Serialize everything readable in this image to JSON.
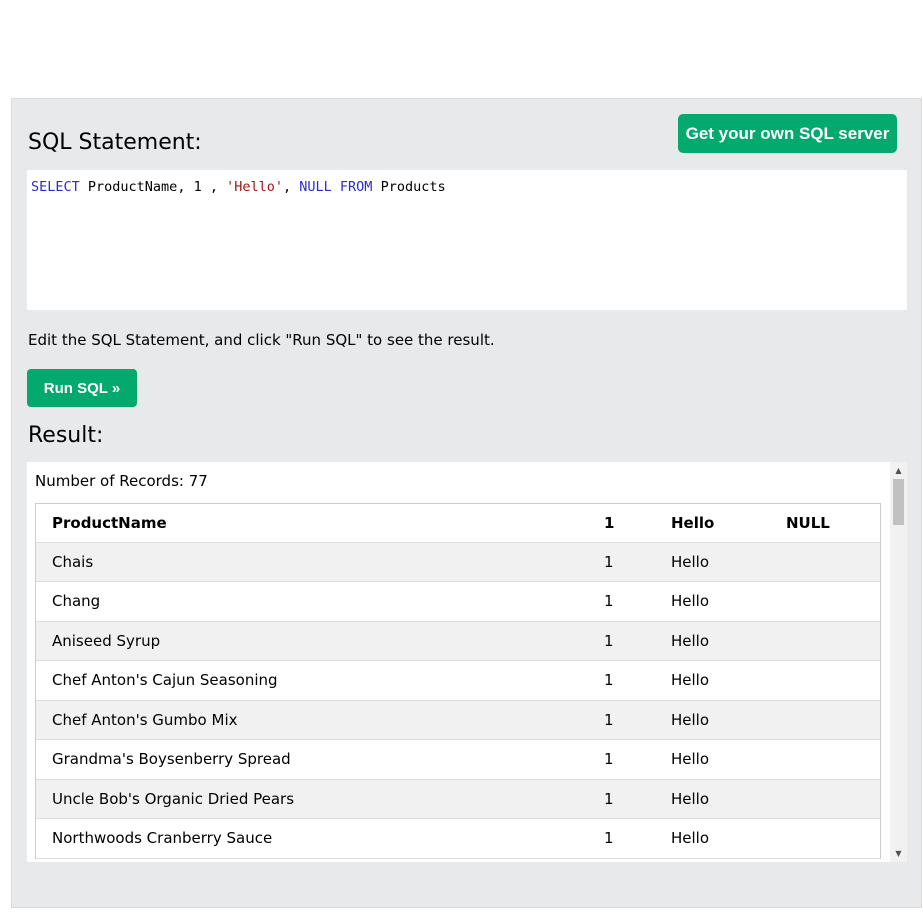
{
  "header": {
    "sql_title": "SQL Statement:",
    "own_server_button": "Get your own SQL server"
  },
  "editor": {
    "tokens": [
      {
        "text": "SELECT",
        "type": "keyword"
      },
      {
        "text": " ProductName, 1 , ",
        "type": "plain"
      },
      {
        "text": "'Hello'",
        "type": "string"
      },
      {
        "text": ", ",
        "type": "plain"
      },
      {
        "text": "NULL",
        "type": "keyword"
      },
      {
        "text": " ",
        "type": "plain"
      },
      {
        "text": "FROM",
        "type": "keyword"
      },
      {
        "text": " Products",
        "type": "plain"
      }
    ]
  },
  "instructions": "Edit the SQL Statement, and click \"Run SQL\" to see the result.",
  "run_button": "Run SQL »",
  "result": {
    "title": "Result:",
    "record_count": "Number of Records: 77",
    "columns": [
      "ProductName",
      "1",
      "Hello",
      "NULL"
    ],
    "rows": [
      [
        "Chais",
        "1",
        "Hello",
        ""
      ],
      [
        "Chang",
        "1",
        "Hello",
        ""
      ],
      [
        "Aniseed Syrup",
        "1",
        "Hello",
        ""
      ],
      [
        "Chef Anton's Cajun Seasoning",
        "1",
        "Hello",
        ""
      ],
      [
        "Chef Anton's Gumbo Mix",
        "1",
        "Hello",
        ""
      ],
      [
        "Grandma's Boysenberry Spread",
        "1",
        "Hello",
        ""
      ],
      [
        "Uncle Bob's Organic Dried Pears",
        "1",
        "Hello",
        ""
      ],
      [
        "Northwoods Cranberry Sauce",
        "1",
        "Hello",
        ""
      ]
    ]
  },
  "colors": {
    "accent": "#04aa6d",
    "panel_bg": "#e7e9eb",
    "keyword": "#2b2bd6",
    "string": "#a31515"
  },
  "icons": {
    "scroll_up": "scroll-up-arrow-icon",
    "scroll_down": "scroll-down-arrow-icon"
  }
}
